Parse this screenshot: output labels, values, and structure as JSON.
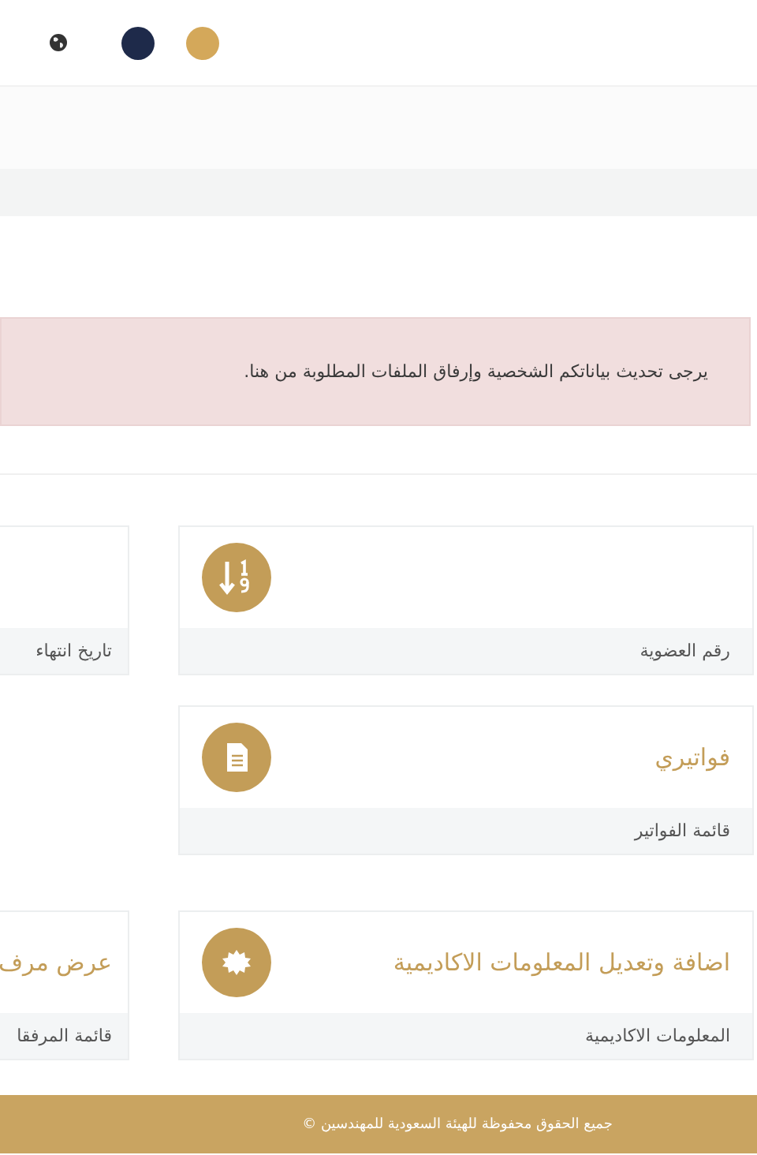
{
  "header": {
    "color_dots": [
      {
        "color": "#1e2a4a"
      },
      {
        "color": "#d4a85a"
      }
    ]
  },
  "alert": {
    "text": "يرجى تحديث بياناتكم الشخصية وإرفاق الملفات المطلوبة من هنا."
  },
  "rows": [
    {
      "cards": [
        {
          "subtitle": "رقم العضوية"
        },
        {
          "subtitle": "تاريخ انتهاء"
        }
      ]
    },
    {
      "cards": [
        {
          "title": "فواتيري",
          "subtitle": "قائمة الفواتير"
        }
      ]
    },
    {
      "cards": [
        {
          "title": "اضافة وتعديل المعلومات الاكاديمية",
          "subtitle": "المعلومات الاكاديمية"
        },
        {
          "title": "عرض مرف",
          "subtitle": "قائمة المرفقا"
        }
      ]
    }
  ],
  "footer": {
    "text": "جميع الحقوق محفوظة للهيئة السعودية للمهندسين ©"
  }
}
